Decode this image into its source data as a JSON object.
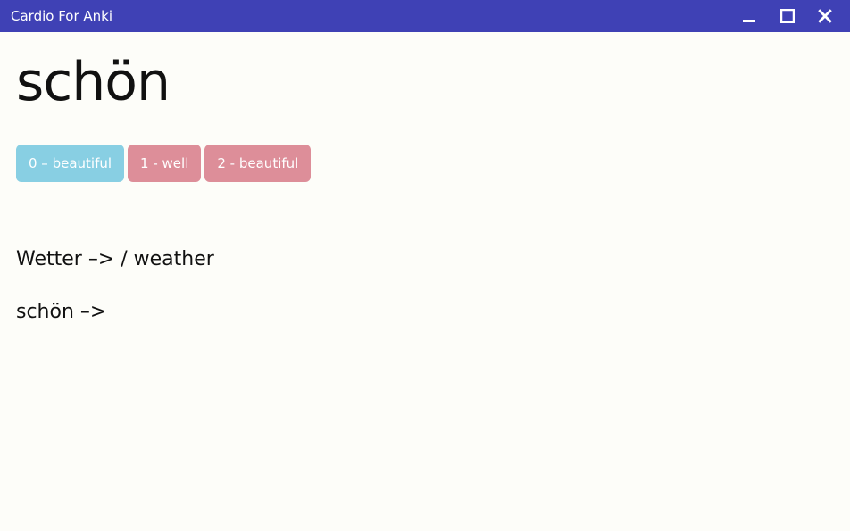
{
  "window": {
    "title": "Cardio For Anki"
  },
  "card": {
    "headword": "schön",
    "answers": [
      {
        "label": "0 – beautiful",
        "selected": true
      },
      {
        "label": "1 - well",
        "selected": false
      },
      {
        "label": "2 - beautiful",
        "selected": false
      }
    ],
    "cloze_line1": "Wetter –>  / weather",
    "cloze_line2": "schön –>"
  }
}
